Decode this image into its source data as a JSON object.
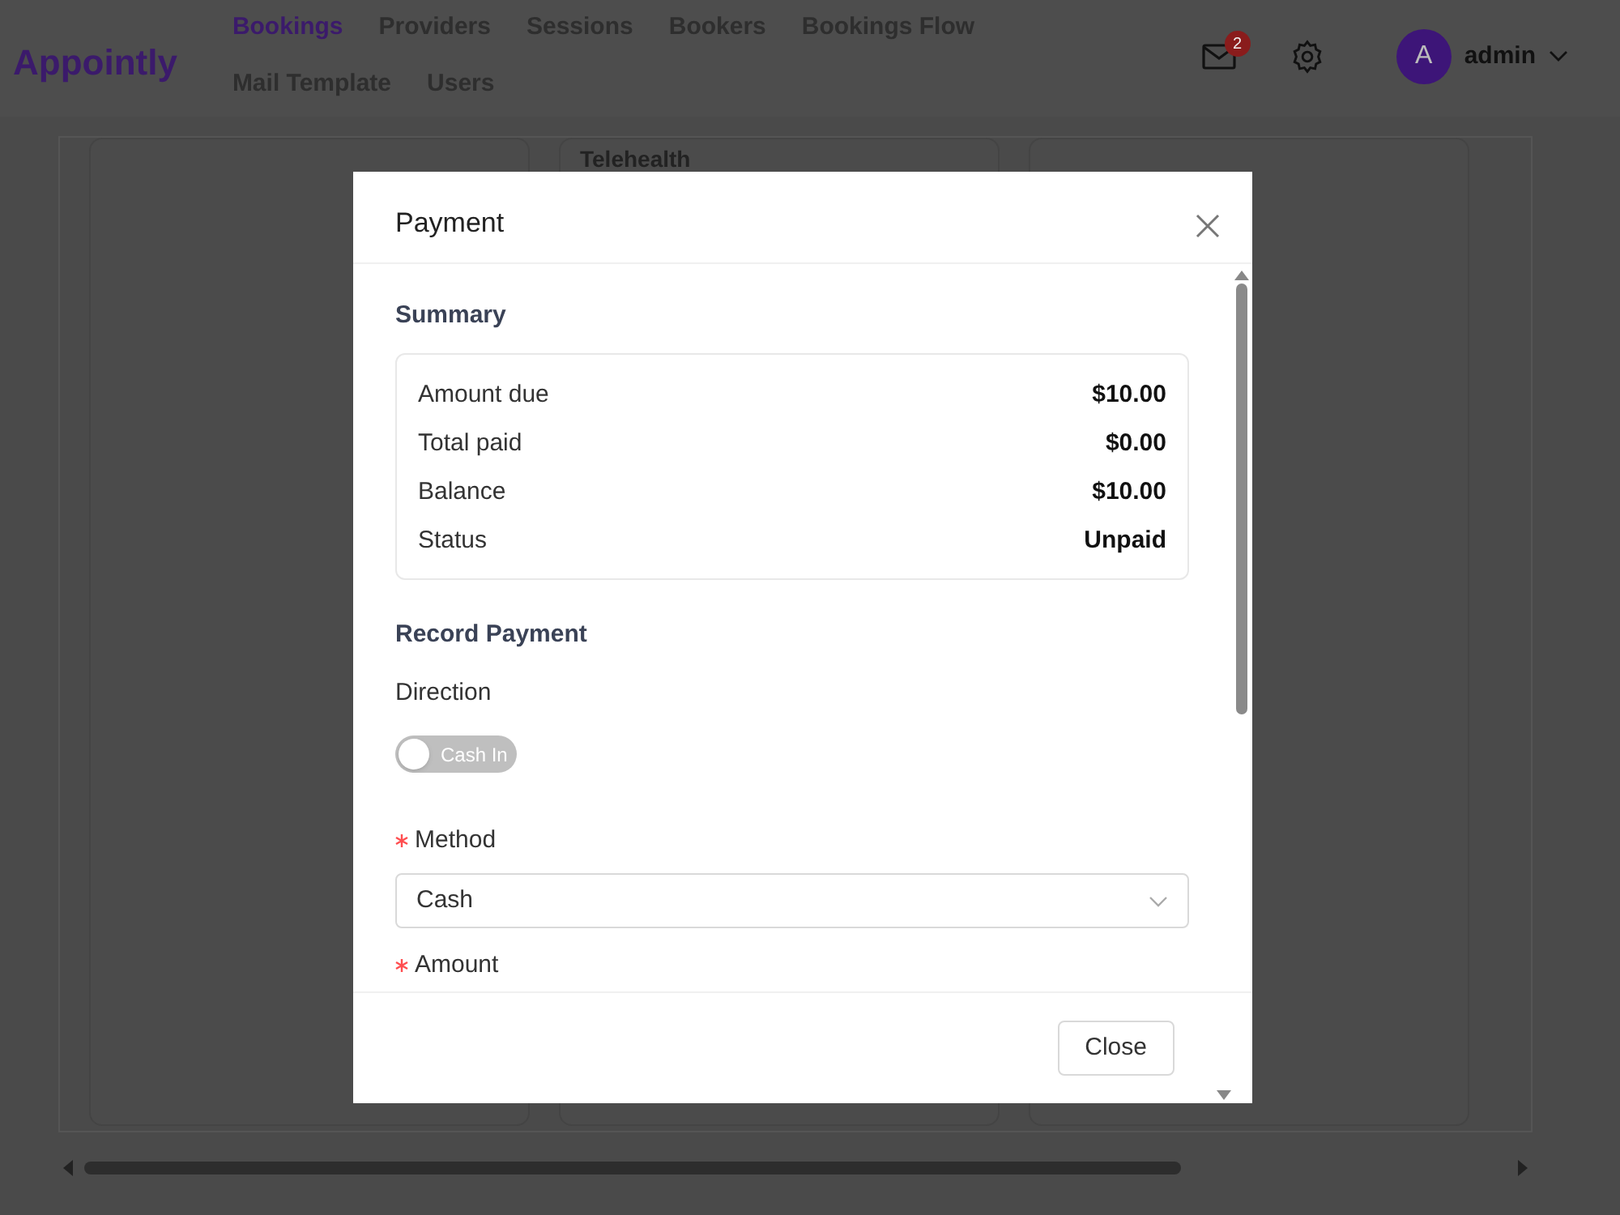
{
  "app": {
    "logo": "Appointly"
  },
  "nav": [
    {
      "label": "Bookings",
      "selected": true
    },
    {
      "label": "Providers",
      "selected": false
    },
    {
      "label": "Sessions",
      "selected": false
    },
    {
      "label": "Bookers",
      "selected": false
    },
    {
      "label": "Bookings Flow",
      "selected": false
    },
    {
      "label": "Mail Template",
      "selected": false
    },
    {
      "label": "Users",
      "selected": false
    }
  ],
  "header": {
    "mail_badge": "2",
    "avatar": "A",
    "user": "admin"
  },
  "background": {
    "column_title": "Telehealth"
  },
  "modal": {
    "title": "Payment",
    "summary": {
      "heading": "Summary",
      "rows": [
        {
          "label": "Amount due",
          "value": "$10.00"
        },
        {
          "label": "Total paid",
          "value": "$0.00"
        },
        {
          "label": "Balance",
          "value": "$10.00"
        },
        {
          "label": "Status",
          "value": "Unpaid"
        }
      ]
    },
    "record": {
      "heading": "Record Payment",
      "direction": {
        "label": "Direction",
        "toggle": {
          "label": "Cash In",
          "checked": false
        }
      },
      "method": {
        "label": "Method",
        "required": true,
        "value": "Cash"
      },
      "amount": {
        "label": "Amount",
        "required": true
      }
    },
    "buttons": [
      "Close"
    ]
  }
}
